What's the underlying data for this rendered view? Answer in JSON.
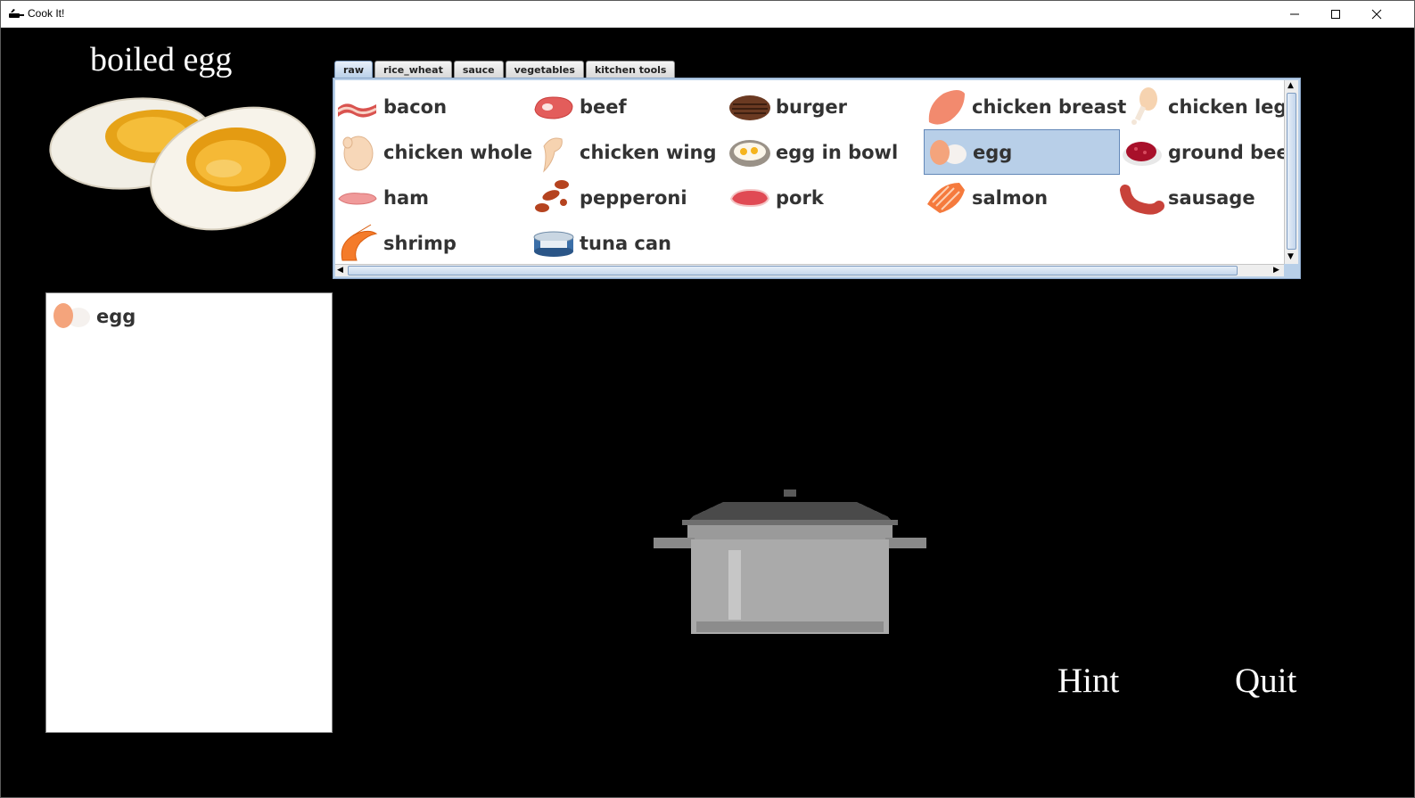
{
  "window": {
    "title": "Cook It!",
    "controls": {
      "minimize": "—",
      "maximize": "☐",
      "close": "✕"
    }
  },
  "recipe": {
    "name": "boiled egg",
    "image_icon": "boiled-egg-halves-icon"
  },
  "tabs": [
    {
      "label": "raw",
      "active": true
    },
    {
      "label": "rice_wheat",
      "active": false
    },
    {
      "label": "sauce",
      "active": false
    },
    {
      "label": "vegetables",
      "active": false
    },
    {
      "label": "kitchen tools",
      "active": false
    }
  ],
  "ingredients": [
    {
      "label": "bacon",
      "icon": "bacon-icon"
    },
    {
      "label": "beef",
      "icon": "beef-icon"
    },
    {
      "label": "burger",
      "icon": "burger-patty-icon"
    },
    {
      "label": "chicken breast",
      "icon": "chicken-breast-icon"
    },
    {
      "label": "chicken leg",
      "icon": "chicken-leg-icon"
    },
    {
      "label": "chicken whole",
      "icon": "chicken-whole-icon"
    },
    {
      "label": "chicken wing",
      "icon": "chicken-wing-icon"
    },
    {
      "label": "egg in bowl",
      "icon": "egg-in-bowl-icon"
    },
    {
      "label": "egg",
      "icon": "egg-icon",
      "selected": true
    },
    {
      "label": "ground beef",
      "icon": "ground-beef-icon"
    },
    {
      "label": "ham",
      "icon": "ham-icon"
    },
    {
      "label": "pepperoni",
      "icon": "pepperoni-icon"
    },
    {
      "label": "pork",
      "icon": "pork-icon"
    },
    {
      "label": "salmon",
      "icon": "salmon-icon"
    },
    {
      "label": "sausage",
      "icon": "sausage-icon"
    },
    {
      "label": "shrimp",
      "icon": "shrimp-icon"
    },
    {
      "label": "tuna can",
      "icon": "tuna-can-icon"
    }
  ],
  "selected_ingredients": [
    {
      "label": "egg",
      "icon": "egg-icon"
    }
  ],
  "cookware": {
    "icon": "cooking-pot-icon"
  },
  "buttons": {
    "hint": "Hint",
    "quit": "Quit"
  },
  "colors": {
    "background": "#000000",
    "selection": "#b8cfe8",
    "tab_active": "#b8cfe8"
  }
}
